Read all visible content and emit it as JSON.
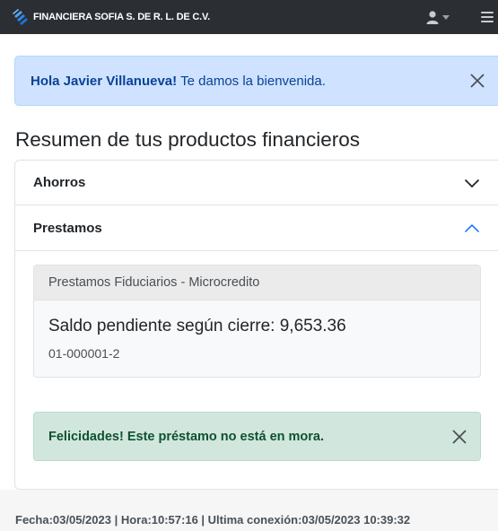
{
  "navbar": {
    "brand": "FINANCIERA SOFIA S. DE R. L. DE C.V.",
    "logo_icon": "company-logo-icon",
    "user_icon": "user-icon",
    "menu_icon": "hamburger-icon"
  },
  "welcome_alert": {
    "greeting": "Hola Javier Villanueva!",
    "message": "Te damos la bienvenida."
  },
  "section_title": "Resumen de tus productos financieros",
  "accordion": {
    "items": [
      {
        "label": "Ahorros",
        "expanded": false
      },
      {
        "label": "Prestamos",
        "expanded": true
      }
    ]
  },
  "loan": {
    "product": "Prestamos Fiduciarios - Microcredito",
    "balance": "Saldo pendiente según cierre: 9,653.36",
    "account": "01-000001-2"
  },
  "success_alert": {
    "message": "Felicidades! Este préstamo no está en mora."
  },
  "footer": {
    "text": "Fecha:03/05/2023 | Hora:10:57:16 | Ultima conexión:03/05/2023 10:39:32"
  },
  "colors": {
    "navbar": "#2b2f33",
    "welcome_bg": "#cfe2ff",
    "welcome_text": "#084298",
    "success_bg": "#d1e7dd",
    "success_text": "#0f5132",
    "chevron_active": "#0d6efd"
  }
}
